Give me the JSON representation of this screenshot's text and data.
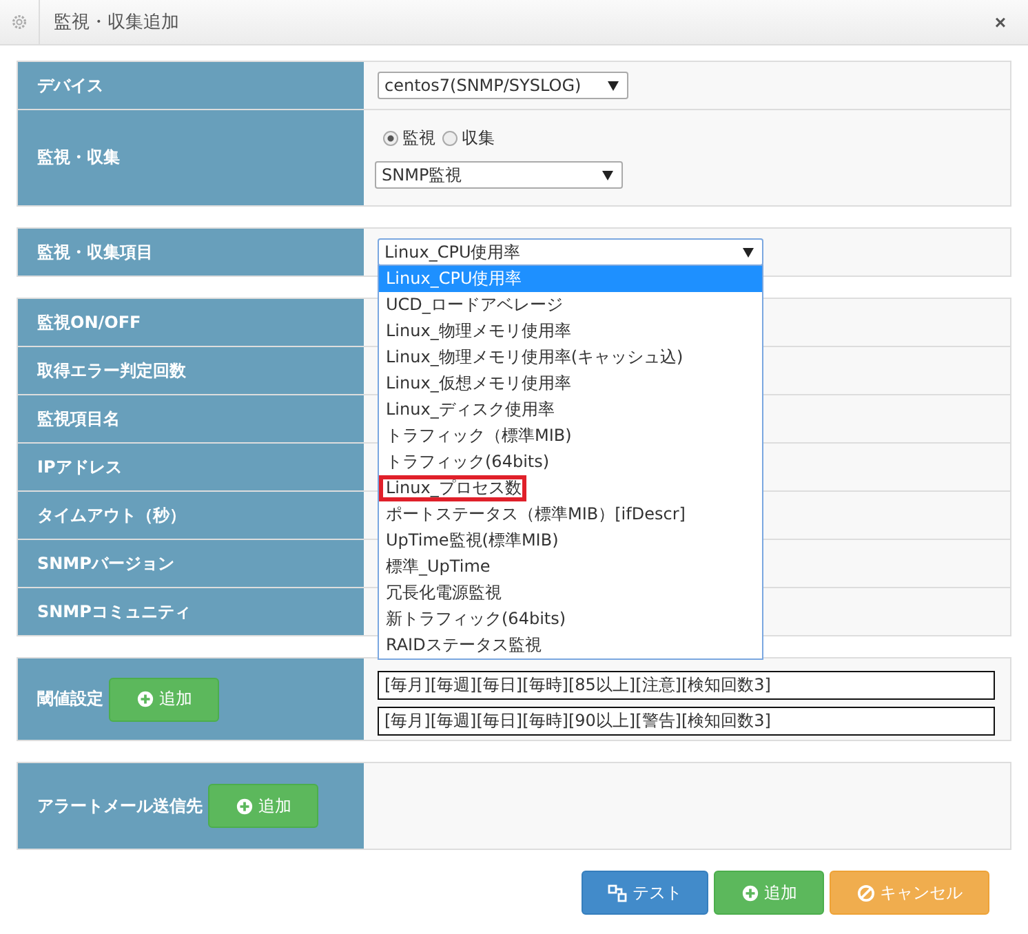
{
  "window": {
    "title": "監視・収集追加",
    "close": "×"
  },
  "device": {
    "label": "デバイス",
    "value": "centos7(SNMP/SYSLOG)"
  },
  "mode": {
    "label": "監視・収集",
    "options": [
      {
        "label": "監視",
        "selected": true
      },
      {
        "label": "収集",
        "selected": false
      }
    ],
    "type_value": "SNMP監視"
  },
  "item": {
    "label": "監視・収集項目",
    "value": "Linux_CPU使用率",
    "options": [
      {
        "label": "Linux_CPU使用率",
        "selected": true,
        "outlined": false
      },
      {
        "label": "UCD_ロードアベレージ",
        "selected": false,
        "outlined": false
      },
      {
        "label": "Linux_物理メモリ使用率",
        "selected": false,
        "outlined": false
      },
      {
        "label": "Linux_物理メモリ使用率(キャッシュ込)",
        "selected": false,
        "outlined": false
      },
      {
        "label": "Linux_仮想メモリ使用率",
        "selected": false,
        "outlined": false
      },
      {
        "label": "Linux_ディスク使用率",
        "selected": false,
        "outlined": false
      },
      {
        "label": "トラフィック（標準MIB)",
        "selected": false,
        "outlined": false
      },
      {
        "label": "トラフィック(64bits)",
        "selected": false,
        "outlined": false
      },
      {
        "label": "Linux_プロセス数",
        "selected": false,
        "outlined": true
      },
      {
        "label": "ポートステータス（標準MIB）[ifDescr]",
        "selected": false,
        "outlined": false
      },
      {
        "label": "UpTime監視(標準MIB)",
        "selected": false,
        "outlined": false
      },
      {
        "label": "標準_UpTime",
        "selected": false,
        "outlined": false
      },
      {
        "label": "冗長化電源監視",
        "selected": false,
        "outlined": false
      },
      {
        "label": "新トラフィック(64bits)",
        "selected": false,
        "outlined": false
      },
      {
        "label": "RAIDステータス監視",
        "selected": false,
        "outlined": false
      }
    ]
  },
  "settings": [
    "監視ON/OFF",
    "取得エラー判定回数",
    "監視項目名",
    "IPアドレス",
    "タイムアウト（秒）",
    "SNMPバージョン",
    "SNMPコミュニティ"
  ],
  "thresholds": {
    "label": "閾値設定",
    "add_button": "追加",
    "rows": [
      "[毎月][毎週][毎日][毎時][85以上][注意][検知回数3]",
      "[毎月][毎週][毎日][毎時][90以上][警告][検知回数3]"
    ]
  },
  "alert_mail": {
    "label": "アラートメール送信先",
    "add_button": "追加"
  },
  "buttons": [
    {
      "kind": "test",
      "label": "テスト"
    },
    {
      "kind": "add",
      "label": "追加"
    },
    {
      "kind": "cancel",
      "label": "キャンセル"
    }
  ]
}
